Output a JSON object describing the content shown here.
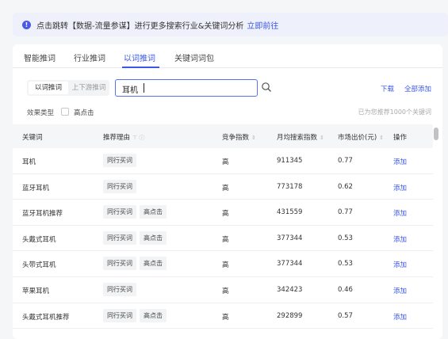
{
  "notice": {
    "icon": "info-icon",
    "text": "点击跳转【数据-流量参谋】进行更多搜索行业&关键词分析",
    "link": "立即前往"
  },
  "tabs": [
    {
      "label": "智能推词",
      "active": false
    },
    {
      "label": "行业推词",
      "active": false
    },
    {
      "label": "以词推词",
      "active": true
    },
    {
      "label": "关键词词包",
      "active": false
    }
  ],
  "segment": {
    "selected": "以词推词",
    "other": "上下游推词"
  },
  "search": {
    "value": "耳机",
    "icon": "search-icon"
  },
  "top_actions": {
    "download": "下载",
    "add_all": "全部添加"
  },
  "filter": {
    "label": "效果类型",
    "checkbox_label": "高点击",
    "checked": false
  },
  "recommend_note": "已为您推荐1000个关键词",
  "table": {
    "columns": [
      "关键词",
      "推荐理由",
      "竞争指数",
      "月均搜索指数",
      "市场出价(元)",
      "操作"
    ],
    "rows": [
      {
        "keyword": "耳机",
        "reasons": [
          "同行买词"
        ],
        "competition": "高",
        "search_index": "911345",
        "price": "0.77",
        "action": "添加"
      },
      {
        "keyword": "蓝牙耳机",
        "reasons": [
          "同行买词"
        ],
        "competition": "高",
        "search_index": "773178",
        "price": "0.62",
        "action": "添加"
      },
      {
        "keyword": "蓝牙耳机推荐",
        "reasons": [
          "同行买词",
          "高点击"
        ],
        "competition": "高",
        "search_index": "431559",
        "price": "0.77",
        "action": "添加"
      },
      {
        "keyword": "头戴式耳机",
        "reasons": [
          "同行买词",
          "高点击"
        ],
        "competition": "高",
        "search_index": "377344",
        "price": "0.53",
        "action": "添加"
      },
      {
        "keyword": "头带式耳机",
        "reasons": [
          "同行买词",
          "高点击"
        ],
        "competition": "高",
        "search_index": "377344",
        "price": "0.53",
        "action": "添加"
      },
      {
        "keyword": "苹果耳机",
        "reasons": [
          "同行买词"
        ],
        "competition": "高",
        "search_index": "342423",
        "price": "0.46",
        "action": "添加"
      },
      {
        "keyword": "头戴式耳机推荐",
        "reasons": [
          "同行买词",
          "高点击"
        ],
        "competition": "高",
        "search_index": "292899",
        "price": "0.57",
        "action": "添加"
      }
    ]
  },
  "colors": {
    "accent": "#3b57e6",
    "notice_bg": "#eef0fb",
    "header_bg": "#f5f6f8"
  }
}
